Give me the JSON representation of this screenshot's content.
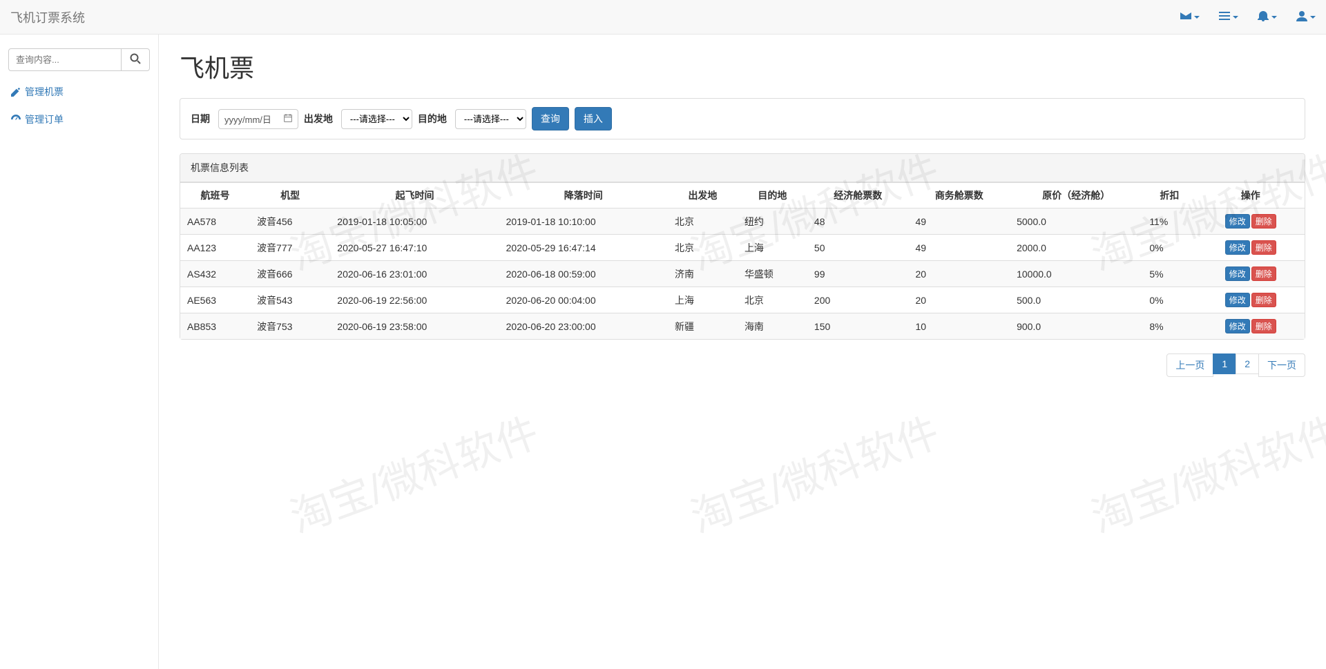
{
  "app": {
    "title": "飞机订票系统"
  },
  "navbar_dropdowns": {
    "mail": "mail",
    "list": "list",
    "bell": "bell",
    "user": "user"
  },
  "sidebar": {
    "search_placeholder": "查询内容...",
    "items": [
      {
        "id": "manage-flights",
        "label": "管理机票",
        "icon": "edit"
      },
      {
        "id": "manage-orders",
        "label": "管理订单",
        "icon": "dashboard"
      }
    ]
  },
  "page": {
    "title": "飞机票"
  },
  "filter": {
    "date_label": "日期",
    "date_placeholder": "yyyy/mm/日",
    "origin_label": "出发地",
    "dest_label": "目的地",
    "select_placeholder": "---请选择---",
    "search_btn": "查询",
    "insert_btn": "插入"
  },
  "table": {
    "heading": "机票信息列表",
    "columns": [
      "航班号",
      "机型",
      "起飞时间",
      "降落时间",
      "出发地",
      "目的地",
      "经济舱票数",
      "商务舱票数",
      "原价（经济舱）",
      "折扣",
      "操作"
    ],
    "rows": [
      {
        "flight_no": "AA578",
        "model": "波音456",
        "depart": "2019-01-18 10:05:00",
        "arrive": "2019-01-18 10:10:00",
        "origin": "北京",
        "dest": "纽约",
        "economy_seats": "48",
        "business_seats": "49",
        "price": "5000.0",
        "discount": "11%"
      },
      {
        "flight_no": "AA123",
        "model": "波音777",
        "depart": "2020-05-27 16:47:10",
        "arrive": "2020-05-29 16:47:14",
        "origin": "北京",
        "dest": "上海",
        "economy_seats": "50",
        "business_seats": "49",
        "price": "2000.0",
        "discount": "0%"
      },
      {
        "flight_no": "AS432",
        "model": "波音666",
        "depart": "2020-06-16 23:01:00",
        "arrive": "2020-06-18 00:59:00",
        "origin": "济南",
        "dest": "华盛顿",
        "economy_seats": "99",
        "business_seats": "20",
        "price": "10000.0",
        "discount": "5%"
      },
      {
        "flight_no": "AE563",
        "model": "波音543",
        "depart": "2020-06-19 22:56:00",
        "arrive": "2020-06-20 00:04:00",
        "origin": "上海",
        "dest": "北京",
        "economy_seats": "200",
        "business_seats": "20",
        "price": "500.0",
        "discount": "0%"
      },
      {
        "flight_no": "AB853",
        "model": "波音753",
        "depart": "2020-06-19 23:58:00",
        "arrive": "2020-06-20 23:00:00",
        "origin": "新疆",
        "dest": "海南",
        "economy_seats": "150",
        "business_seats": "10",
        "price": "900.0",
        "discount": "8%"
      }
    ],
    "edit_btn": "修改",
    "delete_btn": "删除"
  },
  "pagination": {
    "prev": "上一页",
    "next": "下一页",
    "pages": [
      "1",
      "2"
    ],
    "active": "1"
  },
  "watermark_text": "淘宝/微科软件"
}
